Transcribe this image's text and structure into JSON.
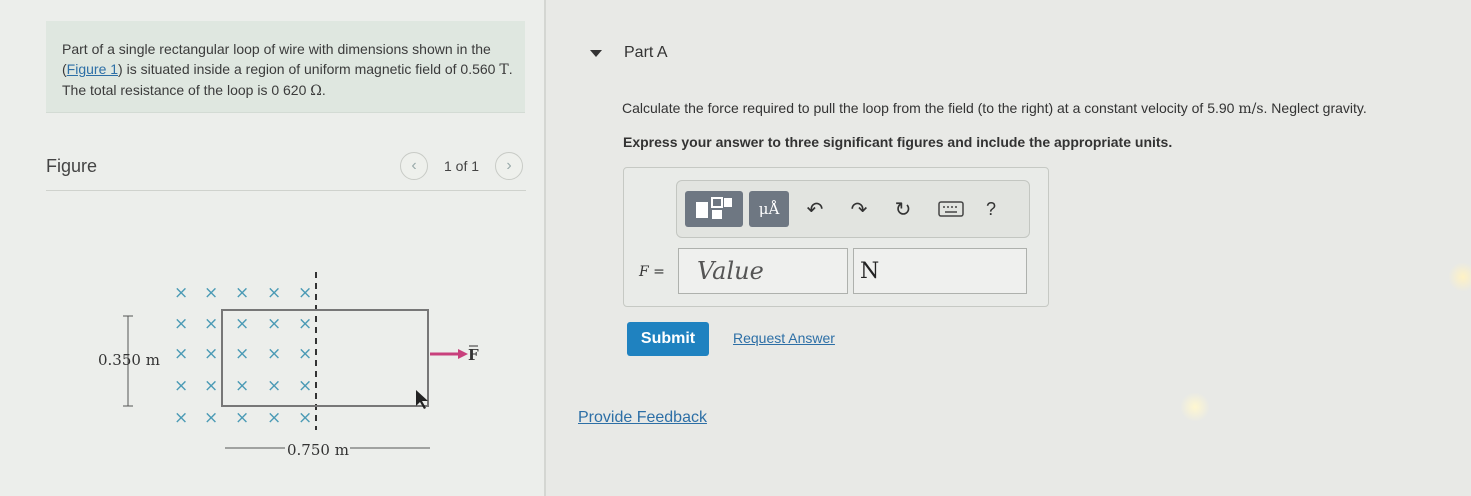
{
  "problem": {
    "text_before_link": "Part of a single rectangular loop of wire with dimensions shown in the (",
    "figure_link": "Figure 1",
    "text_after_link": ") is situated inside a region of uniform magnetic field of 0.560 ",
    "field_unit": "T",
    "text_resistance": ". The total resistance of the loop is 0 620 ",
    "resistance_unit": "Ω",
    "text_end": "."
  },
  "figure": {
    "title": "Figure",
    "counter": "1 of 1",
    "prev_icon": "chevron-left-icon",
    "next_icon": "chevron-right-icon",
    "height_label": "0.350 m",
    "width_label": "0.750 m",
    "force_label": "F",
    "field_symbol": "×"
  },
  "part_a": {
    "title": "Part A",
    "question_before": "Calculate the force required to pull the loop from the field (to the right) at a constant velocity of 5.90 ",
    "velocity_unit": "m/s",
    "question_after": ". Neglect gravity.",
    "instruction": "Express your answer to three significant figures and include the appropriate units."
  },
  "toolbar": {
    "units_label": "μÅ",
    "undo_icon": "undo-icon",
    "redo_icon": "redo-icon",
    "reset_icon": "reset-icon",
    "keyboard_icon": "keyboard-icon",
    "help_label": "?"
  },
  "answer": {
    "variable": "F",
    "equals": "=",
    "value_placeholder": "Value",
    "unit_value": "N"
  },
  "actions": {
    "submit_label": "Submit",
    "request_answer_label": "Request Answer",
    "provide_feedback_label": "Provide Feedback"
  },
  "colors": {
    "link": "#2d6fa6",
    "submit": "#1f82c0",
    "x_marks": "#4a9ab5",
    "force_arrow": "#c8407c"
  }
}
